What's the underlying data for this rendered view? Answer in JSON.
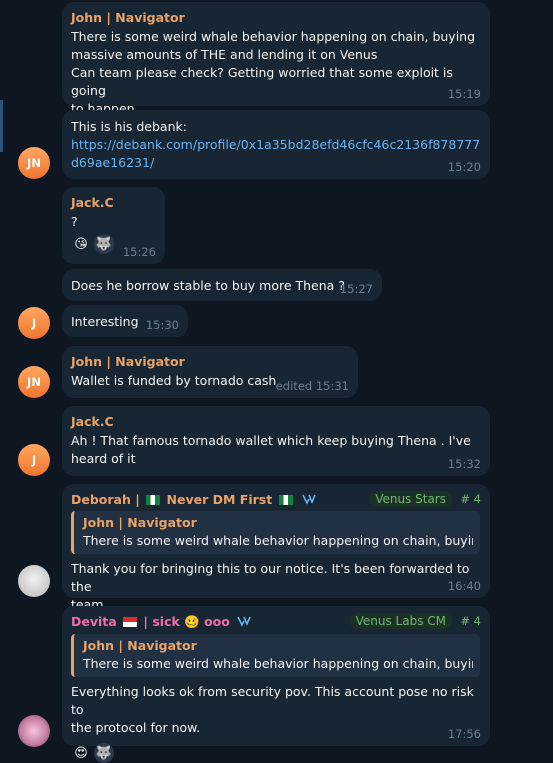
{
  "messages": {
    "m1": {
      "sender": "John | Navigator",
      "text": "There is some weird whale behavior happening on chain, buying\nmassive amounts of THE and lending it on Venus\nCan team please check? Getting worried that some exploit is going\nto happen",
      "time": "15:19"
    },
    "m2": {
      "text": "This is his debank:",
      "link": "https://debank.com/profile/0x1a35bd28efd46cfc46c2136f878777d69ae16231/",
      "time": "15:20",
      "avatar_initials": "JN"
    },
    "m3": {
      "sender": "Jack.C",
      "text": "?",
      "time": "15:26",
      "reactions": [
        "😘",
        "🐺"
      ]
    },
    "m4": {
      "text": "Does he borrow stable to buy more Thena ?",
      "time": "15:27"
    },
    "m5": {
      "text": "Interesting",
      "time": "15:30",
      "avatar_initials": "J"
    },
    "m6": {
      "sender": "John | Navigator",
      "text": "Wallet is funded by tornado cash",
      "time": "edited 15:31",
      "avatar_initials": "JN"
    },
    "m7": {
      "sender": "Jack.C",
      "text": "Ah ! That famous tornado wallet which keep buying Thena . I've\nheard of it",
      "time": "15:32",
      "avatar_initials": "J"
    },
    "m8": {
      "sender": "Deborah |",
      "sender_suffix": "Never DM First",
      "tag": "Venus Stars",
      "count": "# 4",
      "reply_name": "John | Navigator",
      "reply_text": "There is some weird whale behavior happening on chain, buying...",
      "text": "Thank you for bringing this to our notice. It's been forwarded to the\nteam",
      "time": "16:40"
    },
    "m9": {
      "sender": "Devita",
      "sender_suffix": "| sick",
      "sender_emoji": "🥴",
      "sender_tail": "ooo",
      "tag": "Venus Labs CM",
      "count": "# 4",
      "reply_name": "John | Navigator",
      "reply_text": "There is some weird whale behavior happening on chain, buying...",
      "text": "Everything looks ok from security pov. This account pose no risk to\nthe protocol for now.",
      "time": "17:56",
      "reactions": [
        "😍",
        "🐺"
      ]
    }
  },
  "colors": {
    "background": "#0e1621",
    "bubble": "#182533",
    "link": "#6ab3f3",
    "name_orange": "#e8a368",
    "name_pink": "#ed6fa6",
    "tag_green": "#6fb672"
  }
}
